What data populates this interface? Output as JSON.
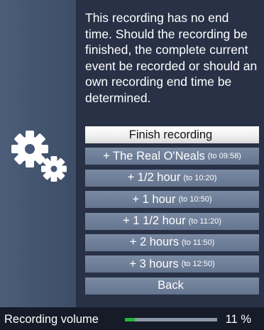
{
  "dialog": {
    "message": "This recording has no end time. Should the recording be finished, the complete current event be recorded or should an own recording end time be determined."
  },
  "menu": {
    "items": [
      {
        "label": "Finish recording",
        "hint": "",
        "selected": true
      },
      {
        "label": "+ The Real O'Neals",
        "hint": "(to 09:58)",
        "selected": false
      },
      {
        "label": "+ 1/2 hour",
        "hint": "(to 10:20)",
        "selected": false
      },
      {
        "label": "+ 1 hour",
        "hint": "(to 10:50)",
        "selected": false
      },
      {
        "label": "+ 1 1/2 hour",
        "hint": "(to 11:20)",
        "selected": false
      },
      {
        "label": "+ 2 hours",
        "hint": "(to 11:50)",
        "selected": false
      },
      {
        "label": "+ 3 hours",
        "hint": "(to 12:50)",
        "selected": false
      },
      {
        "label": "Back",
        "hint": "",
        "selected": false
      }
    ]
  },
  "volume": {
    "label": "Recording volume",
    "level_percent": 11,
    "value_text": "11 %"
  },
  "icons": {
    "settings": "gears-icon"
  },
  "colors": {
    "panel": "#283146",
    "sidebar": "#4b5d78",
    "button": "#6f7f99",
    "selected_button": "#ffffff",
    "volume_fill": "#1fb83a"
  }
}
